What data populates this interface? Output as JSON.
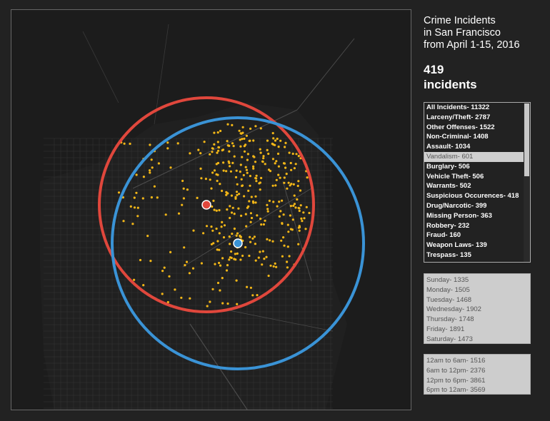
{
  "title": {
    "line1": "Crime Incidents",
    "line2": "in San Francisco",
    "line3": "from April 1-15, 2016"
  },
  "incident_count": {
    "number": "419",
    "label": "incidents"
  },
  "categories": [
    {
      "label": "All Incidents- 11322",
      "selected": false
    },
    {
      "label": "Larceny/Theft- 2787",
      "selected": false
    },
    {
      "label": "Other Offenses- 1522",
      "selected": false
    },
    {
      "label": "Non-Criminal- 1408",
      "selected": false
    },
    {
      "label": "Assault- 1034",
      "selected": false
    },
    {
      "label": "Vandalism- 601",
      "selected": true
    },
    {
      "label": "Burglary- 506",
      "selected": false
    },
    {
      "label": "Vehicle Theft- 506",
      "selected": false
    },
    {
      "label": "Warrants- 502",
      "selected": false
    },
    {
      "label": "Suspicious Occurences- 418",
      "selected": false
    },
    {
      "label": "Drug/Narcotic- 399",
      "selected": false
    },
    {
      "label": "Missing Person- 363",
      "selected": false
    },
    {
      "label": "Robbery- 232",
      "selected": false
    },
    {
      "label": "Fraud- 160",
      "selected": false
    },
    {
      "label": "Weapon Laws- 139",
      "selected": false
    },
    {
      "label": "Trespass- 135",
      "selected": false
    }
  ],
  "days": [
    "Sunday- 1335",
    "Monday- 1505",
    "Tuesday- 1468",
    "Wednesday- 1902",
    "Thursday- 1748",
    "Friday- 1891",
    "Saturday- 1473"
  ],
  "times": [
    "12am to 6am- 1516",
    "6am to 12pm- 2376",
    "12pm to 6pm- 3861",
    "6pm to 12am- 3569"
  ],
  "colors": {
    "background": "#222222",
    "red_circle": "#e0473c",
    "blue_circle": "#3a93d6",
    "incident_dot": "#f2b617",
    "street": "#3a3a3a"
  }
}
